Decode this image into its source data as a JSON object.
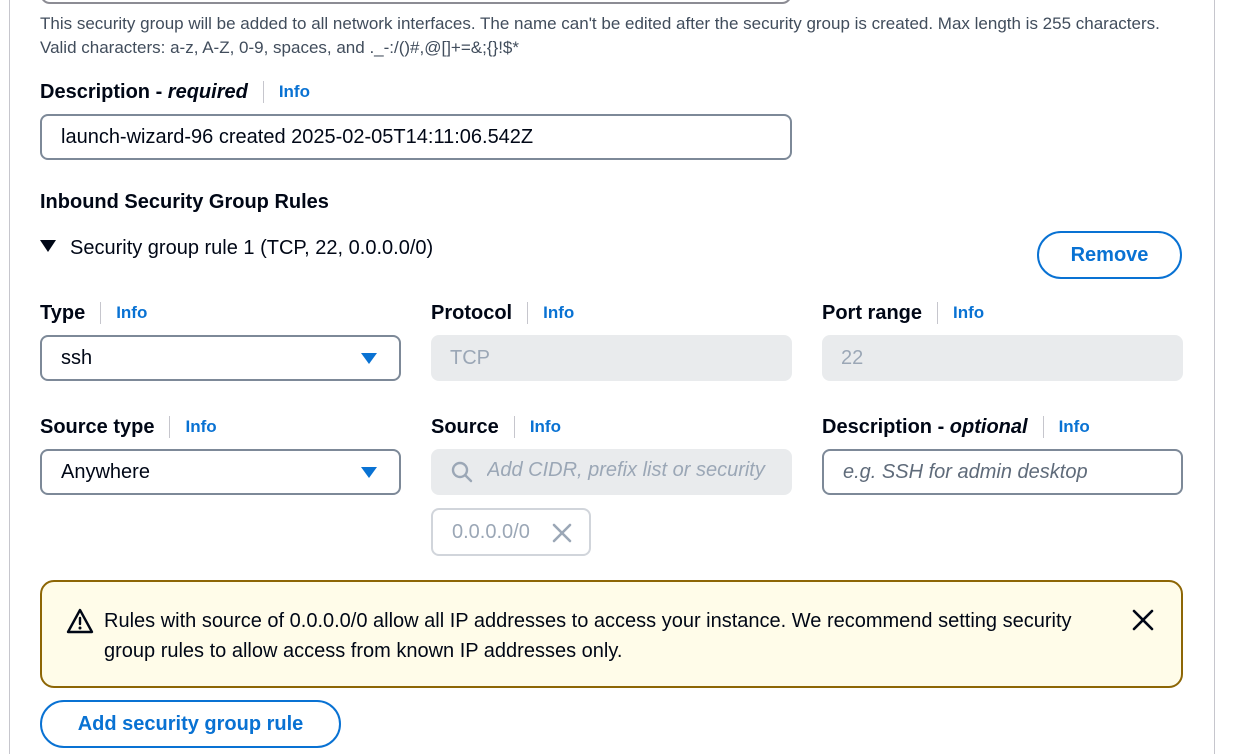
{
  "name_hint": "This security group will be added to all network interfaces. The name can't be edited after the security group is created. Max length is 255 characters. Valid characters: a-z, A-Z, 0-9, spaces, and ._-:/()#,@[]+=&;{}!$*",
  "description": {
    "label_main": "Description - ",
    "label_qualifier": "required",
    "info": "Info",
    "value": "launch-wizard-96 created 2025-02-05T14:11:06.542Z"
  },
  "inbound_rules": {
    "title": "Inbound Security Group Rules",
    "rule": {
      "summary": "Security group rule 1 (TCP, 22, 0.0.0.0/0)",
      "remove_label": "Remove",
      "type": {
        "label": "Type",
        "info": "Info",
        "value": "ssh"
      },
      "protocol": {
        "label": "Protocol",
        "info": "Info",
        "value": "TCP"
      },
      "port_range": {
        "label": "Port range",
        "info": "Info",
        "value": "22"
      },
      "source_type": {
        "label": "Source type",
        "info": "Info",
        "value": "Anywhere"
      },
      "source": {
        "label": "Source",
        "info": "Info",
        "placeholder": "Add CIDR, prefix list or security",
        "tokens": [
          "0.0.0.0/0"
        ]
      },
      "rule_description": {
        "label_main": "Description - ",
        "label_qualifier": "optional",
        "info": "Info",
        "placeholder": "e.g. SSH for admin desktop"
      }
    },
    "warning": "Rules with source of 0.0.0.0/0 allow all IP addresses to access your instance. We recommend setting security group rules to allow access from known IP addresses only.",
    "add_rule_label": "Add security group rule"
  },
  "colors": {
    "link": "#0972d3",
    "warning_border": "#8d6605",
    "warning_bg": "#fffce9",
    "disabled_bg": "#e9ebed"
  }
}
